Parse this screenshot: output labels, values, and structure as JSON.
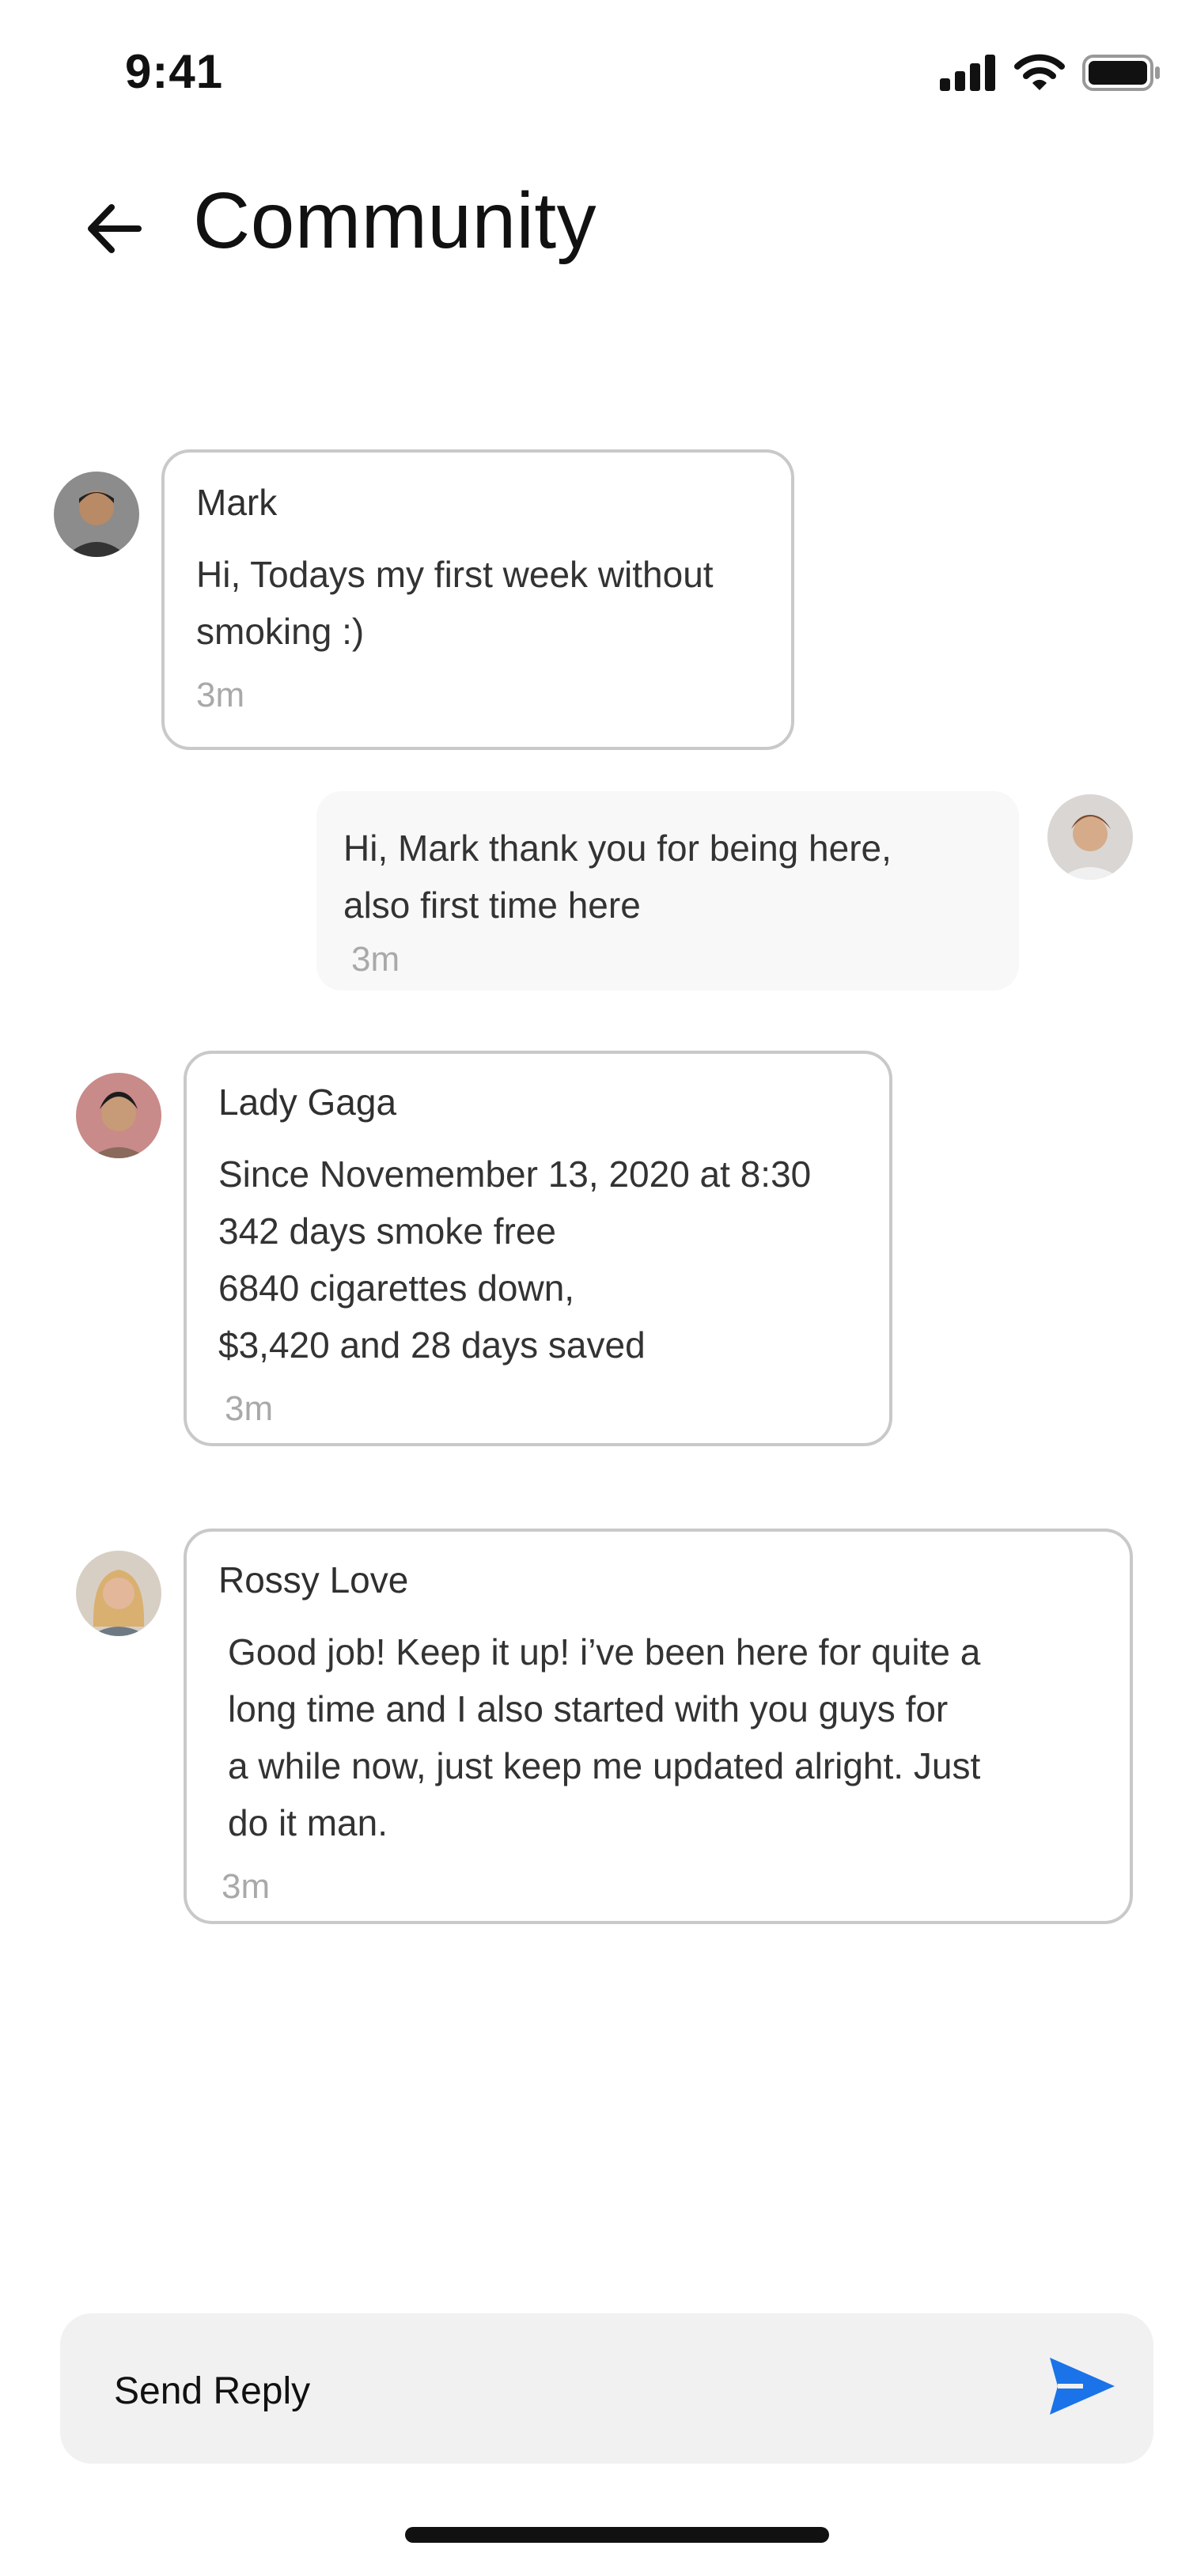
{
  "status_bar": {
    "time": "9:41"
  },
  "header": {
    "title": "Community",
    "back_icon": "arrow-left-icon"
  },
  "messages": [
    {
      "author": "Mark",
      "text": "Hi, Todays my first week without\nsmoking :)",
      "time": "3m"
    },
    {
      "author": "",
      "text": "Hi, Mark thank you for being here,\nalso first time here",
      "time": "3m"
    },
    {
      "author": "Lady Gaga",
      "text": "Since Novemember 13, 2020 at 8:30\n342 days smoke free\n6840 cigarettes down,\n$3,420 and 28 days saved",
      "time": "3m"
    },
    {
      "author": "Rossy Love",
      "text": "Good job! Keep it up! i’ve been here for quite a\nlong time and I also started with you guys for\na while now, just keep me updated alright. Just\ndo it man.",
      "time": "3m"
    }
  ],
  "reply": {
    "placeholder": "Send Reply",
    "send_icon": "send-icon"
  },
  "colors": {
    "accent": "#1a73e8",
    "bubble_border": "#c9c9c9",
    "self_bubble": "#f8f8f8",
    "timestamp": "#a9a9a9",
    "reply_bar": "#f1f1f1"
  }
}
